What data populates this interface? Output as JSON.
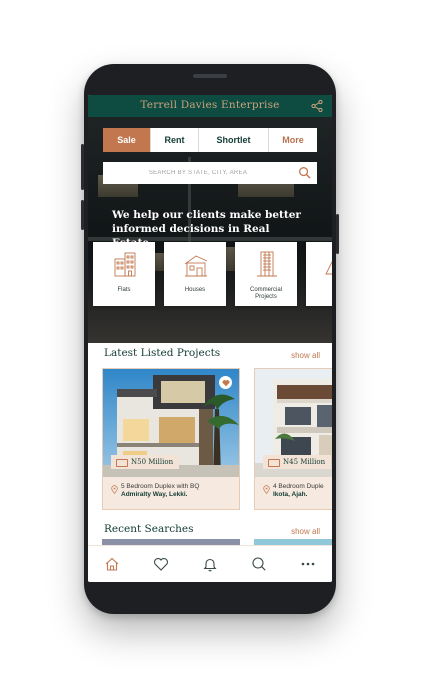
{
  "app": {
    "title": "Terrell Davies Enterprise"
  },
  "tabs": [
    {
      "label": "Sale",
      "active": true
    },
    {
      "label": "Rent",
      "active": false
    },
    {
      "label": "Shortlet",
      "active": false
    },
    {
      "label": "More",
      "active": false
    }
  ],
  "search": {
    "placeholder": "SEARCH BY STATE, CITY, AREA",
    "icon": "search-icon"
  },
  "hero": {
    "tagline": "We help our clients make better informed decisions in Real Estate."
  },
  "categories": [
    {
      "label": "Flats",
      "icon": "flats-building-icon"
    },
    {
      "label": "Houses",
      "icon": "house-icon"
    },
    {
      "label": "Commercial Projects",
      "icon": "commercial-tower-icon"
    },
    {
      "label": "",
      "icon": "land-icon"
    }
  ],
  "latest": {
    "title": "Latest Listed Projects",
    "show_all": "show all",
    "items": [
      {
        "price": "N50 Million",
        "description": "5 Bedroom Duplex with BQ",
        "location": "Admiralty Way, Lekki.",
        "favorite": true
      },
      {
        "price": "N45 Million",
        "description": "4 Bedroom Duple",
        "location": "Ikota, Ajah.",
        "favorite": false
      }
    ]
  },
  "recent": {
    "title": "Recent Searches",
    "show_all": "show all"
  },
  "bottom_nav": [
    {
      "icon": "home-icon",
      "active": true
    },
    {
      "icon": "heart-icon",
      "active": false
    },
    {
      "icon": "bell-icon",
      "active": false
    },
    {
      "icon": "search-icon",
      "active": false
    },
    {
      "icon": "more-icon",
      "active": false
    }
  ],
  "colors": {
    "brand_green": "#0e4b40",
    "accent_copper": "#c2774f",
    "card_bg": "#f6e9df"
  }
}
